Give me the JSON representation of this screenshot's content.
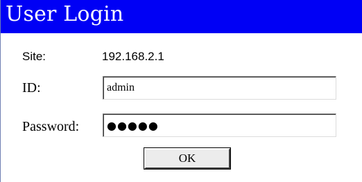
{
  "window": {
    "title": "User Login",
    "title_bar_color": "#0000f5"
  },
  "form": {
    "site_label": "Site:",
    "site_value": "192.168.2.1",
    "id_label": "ID:",
    "id_value": "admin",
    "password_label": "Password:",
    "password_value": "●●●●●",
    "ok_label": "OK"
  }
}
